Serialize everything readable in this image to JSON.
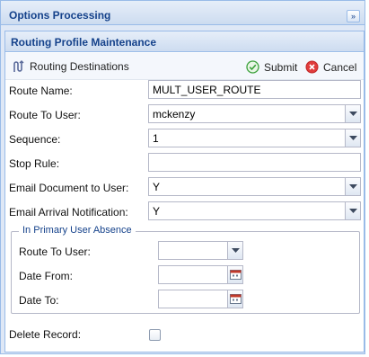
{
  "outer_panel": {
    "title": "Options Processing",
    "collapse_glyph": "»"
  },
  "inner_panel": {
    "title": "Routing Profile Maintenance"
  },
  "toolbar": {
    "routing_destinations_label": "Routing Destinations",
    "routing_destinations_icon": "route-icon",
    "submit_label": "Submit",
    "submit_icon": "check-circle-icon",
    "cancel_label": "Cancel",
    "cancel_icon": "cancel-circle-icon"
  },
  "form": {
    "route_name_label": "Route Name:",
    "route_name_value": "MULT_USER_ROUTE",
    "route_to_user_label": "Route To User:",
    "route_to_user_value": "mckenzy",
    "sequence_label": "Sequence:",
    "sequence_value": "1",
    "stop_rule_label": "Stop Rule:",
    "stop_rule_value": "",
    "email_document_label": "Email Document to User:",
    "email_document_value": "Y",
    "email_arrival_label": "Email Arrival Notification:",
    "email_arrival_value": "Y"
  },
  "absence": {
    "legend": "In Primary User Absence",
    "route_to_user_label": "Route To User:",
    "route_to_user_value": "",
    "date_from_label": "Date From:",
    "date_from_value": "",
    "date_to_label": "Date To:",
    "date_to_value": ""
  },
  "delete_record": {
    "label": "Delete Record:",
    "checked": false
  },
  "colors": {
    "header_text": "#15428b",
    "border": "#99bbe8",
    "submit_green": "#3aa03a",
    "cancel_red": "#e03c3c"
  }
}
